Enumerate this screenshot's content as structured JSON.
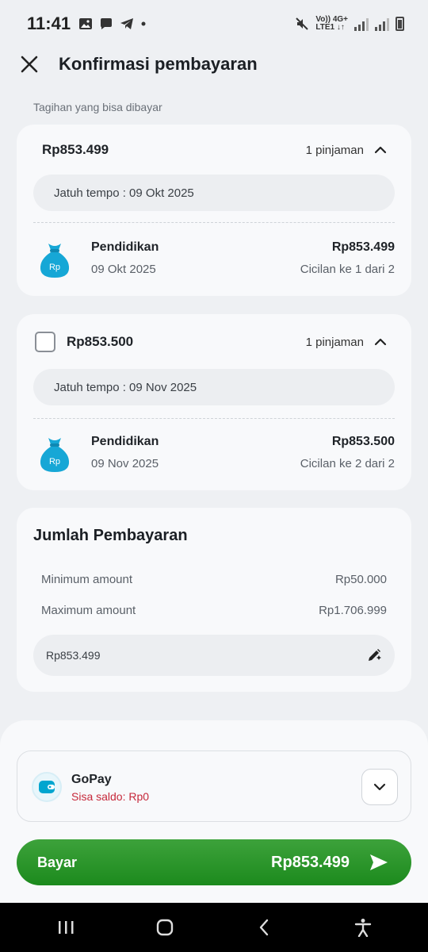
{
  "status_bar": {
    "time": "11:41",
    "network_label_top": "Vo)) 4G+",
    "network_label_bottom": "LTE1 ↓↑"
  },
  "header": {
    "title": "Konfirmasi pembayaran",
    "close_icon": "close-icon"
  },
  "bills_section": {
    "label": "Tagihan yang bisa dibayar"
  },
  "bills": [
    {
      "amount": "Rp853.499",
      "count_label": "1 pinjaman",
      "due_label": "Jatuh tempo : 09 Okt 2025",
      "has_checkbox": false,
      "loan": {
        "name": "Pendidikan",
        "date": "09 Okt 2025",
        "amount": "Rp853.499",
        "installment": "Cicilan ke 1 dari 2"
      }
    },
    {
      "amount": "Rp853.500",
      "count_label": "1 pinjaman",
      "due_label": "Jatuh tempo : 09 Nov 2025",
      "has_checkbox": true,
      "checked": false,
      "loan": {
        "name": "Pendidikan",
        "date": "09 Nov 2025",
        "amount": "Rp853.500",
        "installment": "Cicilan ke 2 dari 2"
      }
    }
  ],
  "payment_amount": {
    "title": "Jumlah Pembayaran",
    "min_label": "Minimum amount",
    "min_value": "Rp50.000",
    "max_label": "Maximum amount",
    "max_value": "Rp1.706.999",
    "input_value": "Rp853.499"
  },
  "payment_method": {
    "name": "GoPay",
    "balance": "Sisa saldo: Rp0"
  },
  "pay_button": {
    "label": "Bayar",
    "total": "Rp853.499"
  },
  "colors": {
    "accent_green": "#1c8a1d",
    "loan_icon_blue": "#16a7d6",
    "error_red": "#c6283a",
    "background": "#eef0f3"
  }
}
